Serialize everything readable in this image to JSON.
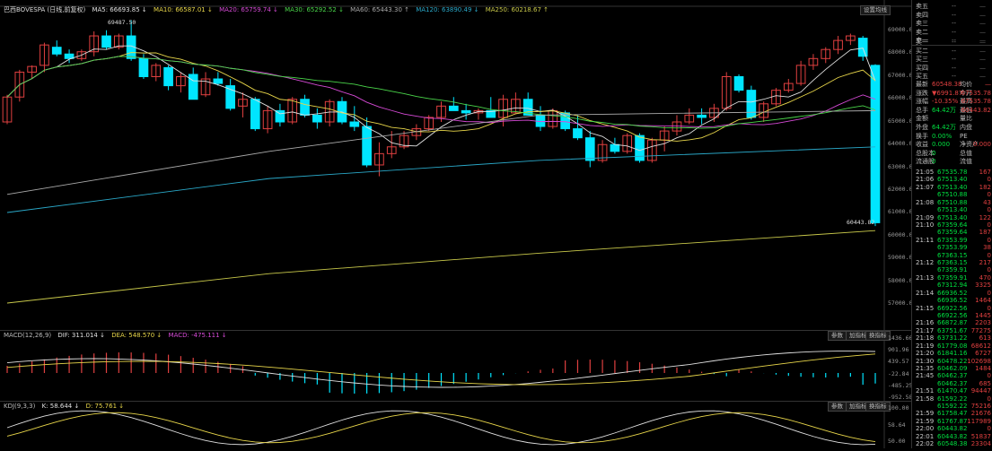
{
  "main": {
    "title": "巴西BOVESPA (日线,前复权)",
    "ma": [
      {
        "label": "MA5: 66693.85 ↓",
        "color": "#e0e0e0"
      },
      {
        "label": "MA10: 66587.01 ↓",
        "color": "#e8d64a"
      },
      {
        "label": "MA20: 65759.74 ↓",
        "color": "#d64ad6"
      },
      {
        "label": "MA30: 65292.52 ↓",
        "color": "#4ad64a"
      },
      {
        "label": "MA60: 65443.30 ↑",
        "color": "#aaaaaa"
      },
      {
        "label": "MA120: 63890.49 ↓",
        "color": "#2aa8c8"
      },
      {
        "label": "MA250: 60218.67 ↑",
        "color": "#c8c84a"
      }
    ],
    "high_label": "69487.50",
    "low_label": "60443.82",
    "settings_btn": "设置均线",
    "yaxis": [
      "69000.0",
      "68000.0",
      "67000.0",
      "66000.0",
      "65000.0",
      "64000.0",
      "63000.0",
      "62000.0",
      "61000.0",
      "60000.0",
      "59000.0",
      "58000.0",
      "57000.0"
    ]
  },
  "macd": {
    "title": "MACD(12,26,9)",
    "dif": "DIF: 311.014 ↓",
    "dea": "DEA: 548.570 ↓",
    "macd": "MACD: -475.111 ↓",
    "btn1": "参数",
    "btn2": "加指标",
    "btn3": "换指标",
    "yaxis": [
      "1436.66",
      "901.96",
      "439.57",
      "-22.84",
      "-485.25",
      "-952.58"
    ]
  },
  "kdj": {
    "title": "KDJ(9,3,3)",
    "k": "K: 58.644 ↓",
    "d": "D: 75.761 ↓",
    "btn1": "参数",
    "btn2": "加指标",
    "btn3": "换指标",
    "yaxis": [
      "100.00",
      "58.64",
      "50.00"
    ]
  },
  "panel": {
    "sell": [
      {
        "label": "卖五",
        "dash": "--"
      },
      {
        "label": "卖四",
        "dash": "--"
      },
      {
        "label": "卖三",
        "dash": "--"
      },
      {
        "label": "卖二",
        "dash": "--"
      },
      {
        "label": "卖一",
        "dash": "--"
      }
    ],
    "buy": [
      {
        "label": "买一",
        "dash": "--"
      },
      {
        "label": "买二",
        "dash": "--"
      },
      {
        "label": "买三",
        "dash": "--"
      },
      {
        "label": "买四",
        "dash": "--"
      },
      {
        "label": "买五",
        "dash": "--"
      }
    ],
    "stats": [
      {
        "l": "最新",
        "v": "60548.38",
        "l2": "均价",
        "v2": "—"
      },
      {
        "l": "涨跌",
        "v": "▼6991.87",
        "l2": "今开",
        "v2": "67535.78"
      },
      {
        "l": "涨幅",
        "v": "-10.35%",
        "l2": "最高",
        "v2": "67535.78"
      },
      {
        "l": "总手",
        "v": "64.42万",
        "l2": "最低",
        "v2": "60443.82"
      },
      {
        "l": "金额",
        "v": "",
        "l2": "量比",
        "v2": ""
      },
      {
        "l": "外盘",
        "v": "64.42万",
        "l2": "内盘",
        "v2": ""
      },
      {
        "l": "换手",
        "v": "0.00%",
        "l2": "PE",
        "v2": ""
      },
      {
        "l": "收益",
        "v": "0.000",
        "l2": "净资产",
        "v2": "0.000"
      },
      {
        "l": "总股本",
        "v": "0",
        "l2": "总值",
        "v2": ""
      },
      {
        "l": "流通股",
        "v": "0",
        "l2": "流值",
        "v2": ""
      }
    ],
    "ticks": [
      {
        "t": "21:05",
        "p": "67535.78",
        "v": "167",
        "c": "#e04040"
      },
      {
        "t": "21:06",
        "p": "67513.40",
        "v": "0",
        "c": "#e04040"
      },
      {
        "t": "21:07",
        "p": "67513.40",
        "v": "182",
        "c": "#e04040"
      },
      {
        "t": "",
        "p": "67510.88",
        "v": "0",
        "c": "#e04040"
      },
      {
        "t": "21:08",
        "p": "67510.88",
        "v": "43",
        "c": "#e04040"
      },
      {
        "t": "",
        "p": "67513.40",
        "v": "0",
        "c": "#e04040"
      },
      {
        "t": "21:09",
        "p": "67513.40",
        "v": "122",
        "c": "#e04040"
      },
      {
        "t": "21:10",
        "p": "67359.64",
        "v": "0",
        "c": "#e04040"
      },
      {
        "t": "",
        "p": "67359.64",
        "v": "187",
        "c": "#e04040"
      },
      {
        "t": "21:11",
        "p": "67353.99",
        "v": "0",
        "c": "#e04040"
      },
      {
        "t": "",
        "p": "67353.99",
        "v": "38",
        "c": "#e04040"
      },
      {
        "t": "",
        "p": "67363.15",
        "v": "0",
        "c": "#e04040"
      },
      {
        "t": "21:12",
        "p": "67363.15",
        "v": "217",
        "c": "#e04040"
      },
      {
        "t": "",
        "p": "67359.91",
        "v": "0",
        "c": "#e04040"
      },
      {
        "t": "21:13",
        "p": "67359.91",
        "v": "470",
        "c": "#e04040"
      },
      {
        "t": "",
        "p": "67312.94",
        "v": "3325",
        "c": "#e04040"
      },
      {
        "t": "21:14",
        "p": "66936.52",
        "v": "0",
        "c": "#e04040"
      },
      {
        "t": "",
        "p": "66936.52",
        "v": "1464",
        "c": "#e04040"
      },
      {
        "t": "21:15",
        "p": "66922.56",
        "v": "0",
        "c": "#e04040"
      },
      {
        "t": "",
        "p": "66922.56",
        "v": "1445",
        "c": "#e04040"
      },
      {
        "t": "21:16",
        "p": "66872.87",
        "v": "2203",
        "c": "#e04040"
      },
      {
        "t": "21:17",
        "p": "63751.67",
        "v": "77275",
        "c": "#e04040"
      },
      {
        "t": "21:18",
        "p": "63731.22",
        "v": "613",
        "c": "#e04040"
      },
      {
        "t": "21:19",
        "p": "61779.08",
        "v": "68612",
        "c": "#e04040"
      },
      {
        "t": "21:20",
        "p": "61841.16",
        "v": "6727",
        "c": "#e04040"
      },
      {
        "t": "21:30",
        "p": "60478.22",
        "v": "102698",
        "c": "#e04040"
      },
      {
        "t": "21:35",
        "p": "60462.09",
        "v": "1484",
        "c": "#e04040"
      },
      {
        "t": "21:45",
        "p": "60462.37",
        "v": "0",
        "c": "#e04040"
      },
      {
        "t": "",
        "p": "60462.37",
        "v": "685",
        "c": "#e04040"
      },
      {
        "t": "21:51",
        "p": "61470.47",
        "v": "94447",
        "c": "#e04040"
      },
      {
        "t": "21:58",
        "p": "61592.22",
        "v": "0",
        "c": "#e04040"
      },
      {
        "t": "",
        "p": "61592.22",
        "v": "75216",
        "c": "#e04040"
      },
      {
        "t": "21:59",
        "p": "61758.47",
        "v": "21676",
        "c": "#e04040"
      },
      {
        "t": "21:59",
        "p": "61767.87",
        "v": "117989",
        "c": "#e04040"
      },
      {
        "t": "22:00",
        "p": "60443.82",
        "v": "0",
        "c": "#e04040"
      },
      {
        "t": "22:01",
        "p": "60443.82",
        "v": "51837",
        "c": "#e04040"
      },
      {
        "t": "22:02",
        "p": "60548.38",
        "v": "23304",
        "c": "#e04040"
      }
    ]
  },
  "colors": {
    "up": "#e04040",
    "down": "#00e5ff",
    "bg": "#000000"
  }
}
